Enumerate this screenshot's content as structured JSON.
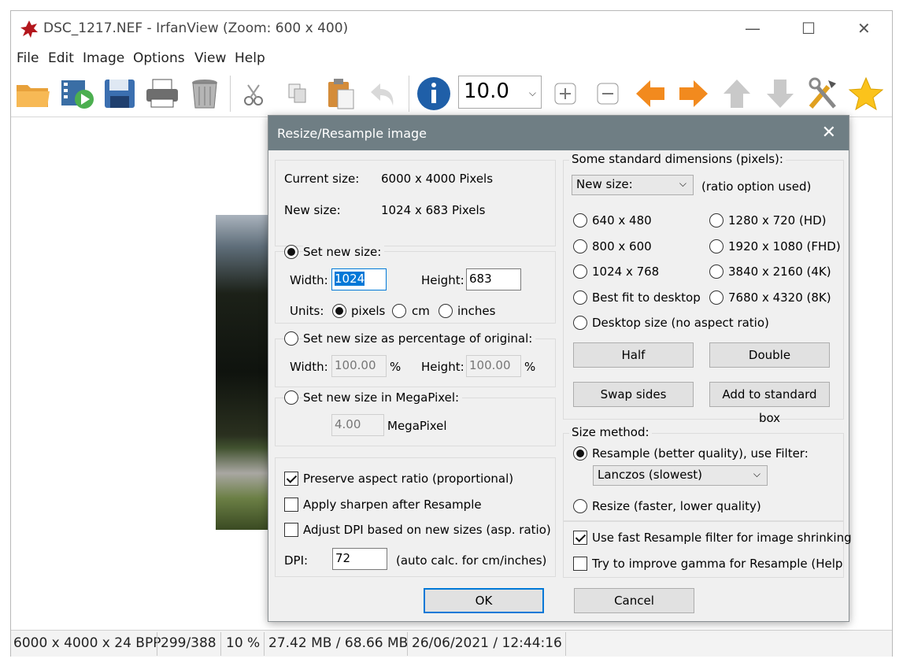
{
  "window": {
    "title": "DSC_1217.NEF - IrfanView (Zoom: 600 x 400)",
    "minimize": "—",
    "maximize": "☐",
    "close": "✕"
  },
  "menu": [
    "File",
    "Edit",
    "Image",
    "Options",
    "View",
    "Help"
  ],
  "toolbar": {
    "zoom_value": "10.0"
  },
  "status": {
    "dims": "6000 x 4000 x 24 BPP",
    "index": "299/388",
    "zoom": "10 %",
    "memory": "27.42 MB / 68.66 MB",
    "datetime": "26/06/2021 / 12:44:16"
  },
  "dialog": {
    "title": "Resize/Resample image",
    "current_size_label": "Current size:",
    "current_size_value": "6000  x  4000  Pixels",
    "new_size_label": "New size:",
    "new_size_value": "1024  x  683  Pixels",
    "set_new_size": "Set new size:",
    "width_label": "Width:",
    "height_label": "Height:",
    "width_value": "1024",
    "height_value": "683",
    "units_label": "Units:",
    "units": [
      "pixels",
      "cm",
      "inches"
    ],
    "set_percentage": "Set new size as percentage of original:",
    "pct_width_value": "100.00",
    "pct_height_value": "100.00",
    "pct_symbol": "%",
    "set_megapixel": "Set new size in MegaPixel:",
    "megapixel_value": "4.00",
    "megapixel_unit": "MegaPixel",
    "preserve_aspect": "Preserve aspect ratio (proportional)",
    "apply_sharpen": "Apply sharpen after Resample",
    "adjust_dpi": "Adjust DPI based on new sizes (asp. ratio)",
    "dpi_label": "DPI:",
    "dpi_value": "72",
    "dpi_note": "(auto calc. for cm/inches)",
    "std_dims_title": "Some standard dimensions (pixels):",
    "new_size_combo": "New size:",
    "ratio_note": "(ratio option used)",
    "std_options": [
      "640 x 480",
      "1280 x 720   (HD)",
      "800 x 600",
      "1920 x 1080 (FHD)",
      "1024 x 768",
      "3840 x 2160 (4K)",
      "Best fit to desktop",
      "7680 x 4320 (8K)",
      "Desktop size (no aspect ratio)"
    ],
    "half": "Half",
    "double": "Double",
    "swap_sides": "Swap sides",
    "add_standard": "Add to standard box",
    "size_method_title": "Size method:",
    "resample_option": "Resample (better quality), use Filter:",
    "filter_value": "Lanczos (slowest)",
    "resize_option": "Resize (faster, lower quality)",
    "fast_resample": "Use fast Resample filter for image shrinking",
    "improve_gamma": "Try to improve gamma for Resample (Help file",
    "ok": "OK",
    "cancel": "Cancel"
  }
}
